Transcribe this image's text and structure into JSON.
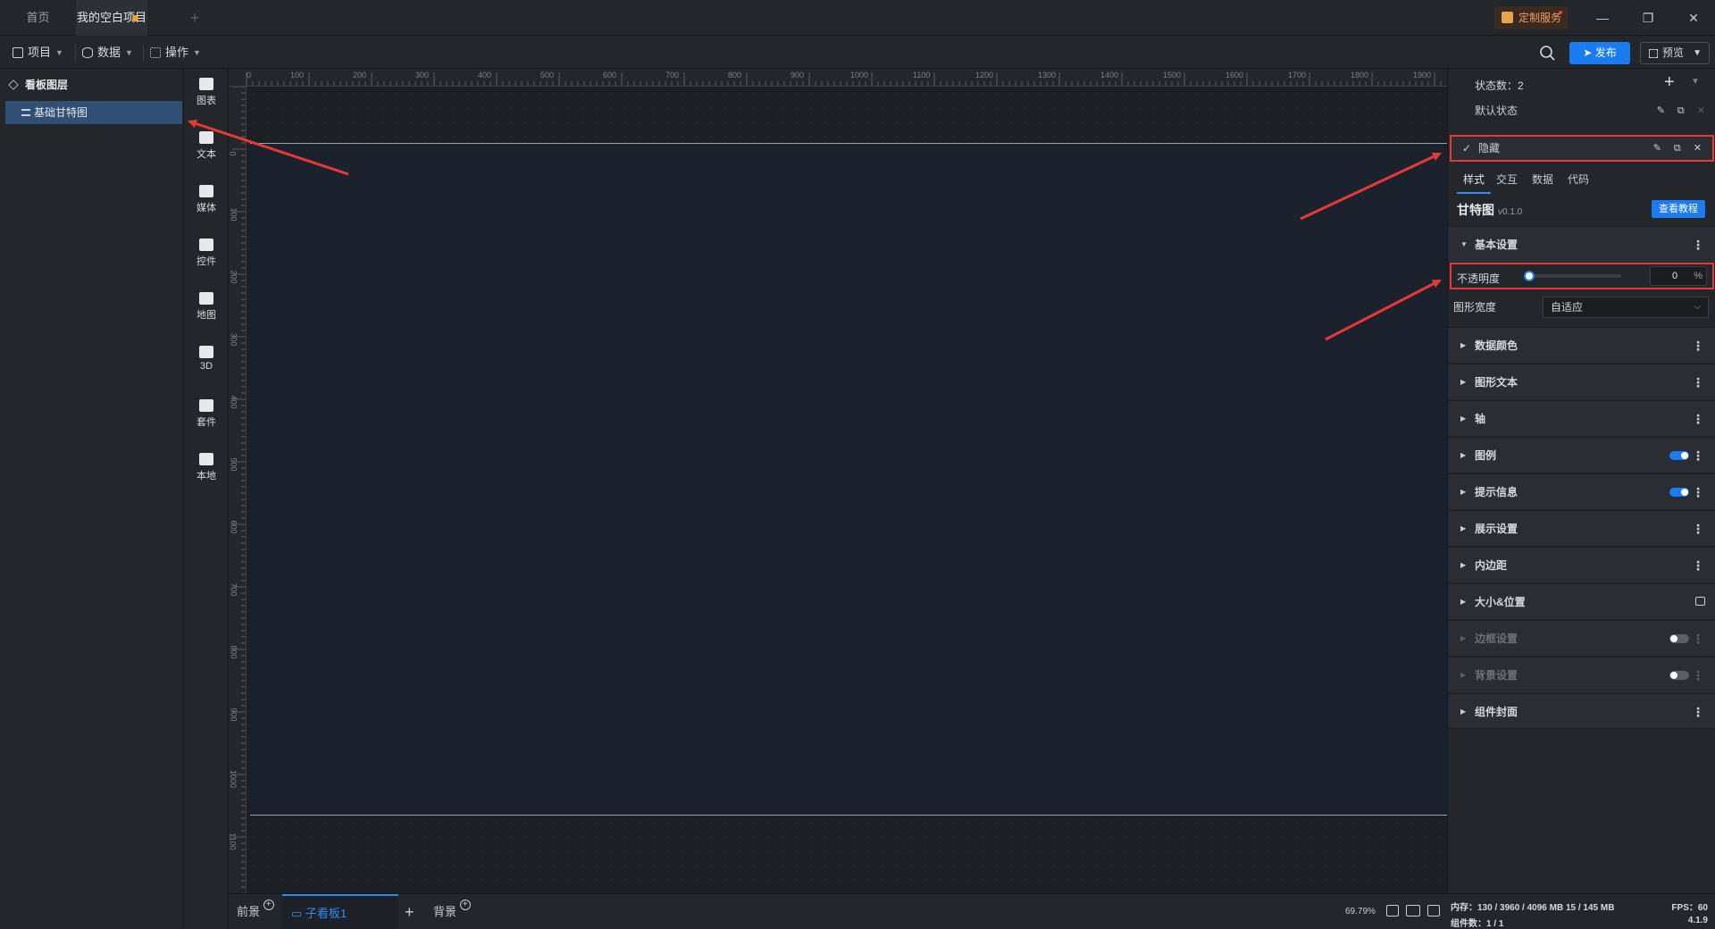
{
  "tabs": {
    "home": "首页",
    "active": "我的空白项目",
    "custom_service": "定制服务"
  },
  "toolbar": {
    "menus": [
      "项目",
      "数据",
      "操作"
    ],
    "publish": "发布",
    "preview": "预览"
  },
  "layers": {
    "title": "看板图层",
    "items": [
      "基础甘特图"
    ]
  },
  "components": [
    "图表",
    "文本",
    "媒体",
    "控件",
    "地图",
    "3D",
    "套件",
    "本地"
  ],
  "rulers": {
    "top": [
      "0",
      "100",
      "200",
      "300",
      "400",
      "500",
      "600",
      "700",
      "800",
      "900",
      "1000",
      "1100",
      "1200",
      "1300",
      "1400",
      "1500",
      "1600",
      "1700",
      "1800",
      "1900"
    ],
    "left": [
      "0",
      "100",
      "200",
      "300",
      "400",
      "500",
      "600",
      "700",
      "800",
      "900",
      "1000",
      "1100"
    ]
  },
  "bottom_tabs": {
    "foreground": "前景",
    "sub_board": "子看板1",
    "background": "背景",
    "zoom": "69.79%"
  },
  "states": {
    "count_label": "状态数：2",
    "items": [
      "默认状态",
      "隐藏"
    ]
  },
  "prop_tabs": [
    "样式",
    "交互",
    "数据",
    "代码"
  ],
  "component": {
    "name": "甘特图",
    "version": "v0.1.0",
    "tutorial": "查看教程"
  },
  "basic": {
    "title": "基本设置",
    "opacity_label": "不透明度",
    "opacity_value": "0",
    "opacity_unit": "%",
    "opacity_fraction": 0,
    "width_label": "图形宽度",
    "width_value": "自适应"
  },
  "sections": [
    "数据颜色",
    "图形文本",
    "轴",
    "图例",
    "提示信息",
    "展示设置",
    "内边距",
    "大小&位置",
    "边框设置",
    "背景设置",
    "组件封面"
  ],
  "status": {
    "memory": "内存：130 / 3960 / 4096 MB  15 / 145 MB",
    "fps": "FPS：60",
    "components": "组件数：1 / 1",
    "version": "4.1.9"
  },
  "colors": {
    "accent": "#1a7cf0",
    "annotation": "#e53935",
    "selected_layer": "#2f4f74",
    "unsaved_dot": "#f5a623"
  }
}
